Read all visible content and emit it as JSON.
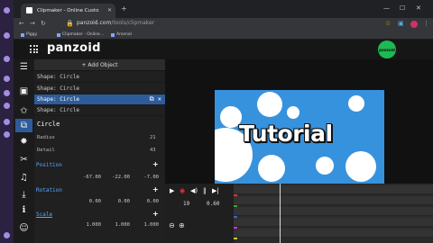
{
  "browser": {
    "tab_title": "Clipmaker - Online Custo",
    "url_host": "panzoid.com",
    "url_path": "/tools/clipmaker",
    "bookmarks": [
      "Piggy",
      "Clipmaker - Online...",
      "Arsenal"
    ],
    "window_controls": {
      "minimize": "—",
      "maximize": "☐",
      "close": "✕"
    },
    "new_tab": "+"
  },
  "app": {
    "brand": "panzoid",
    "avatar_label": "panzoid"
  },
  "tools": [
    "menu",
    "image",
    "star",
    "shape",
    "burst",
    "tools",
    "music",
    "download",
    "info",
    "smile"
  ],
  "panel": {
    "add_object": "+ Add Object",
    "layers": [
      "Shape: Circle",
      "Shape: Circle",
      "Shape: Circle",
      "Shape: Circle"
    ],
    "selected_layer": 2,
    "properties_title": "Circle",
    "radius_label": "Radius",
    "radius_value": "21",
    "detail_label": "Detail",
    "detail_value": "43",
    "position_label": "Position",
    "position_values": [
      "-67.00",
      "-22.00",
      "-7.00"
    ],
    "rotation_label": "Rotation",
    "rotation_values": [
      "0.00",
      "0.00",
      "0.00"
    ],
    "scale_label": "Scale",
    "scale_values": [
      "1.000",
      "1.000",
      "1.000"
    ]
  },
  "stage": {
    "text": "Tutorial",
    "background": "#3792dd"
  },
  "timeline": {
    "frame": "19",
    "time": "0.60",
    "controls": [
      "play",
      "record",
      "audio",
      "waveform",
      "skip"
    ]
  },
  "colors": {
    "accent": "#2e5b9a",
    "section": "#5aa6ff",
    "avatar": "#1db954"
  }
}
